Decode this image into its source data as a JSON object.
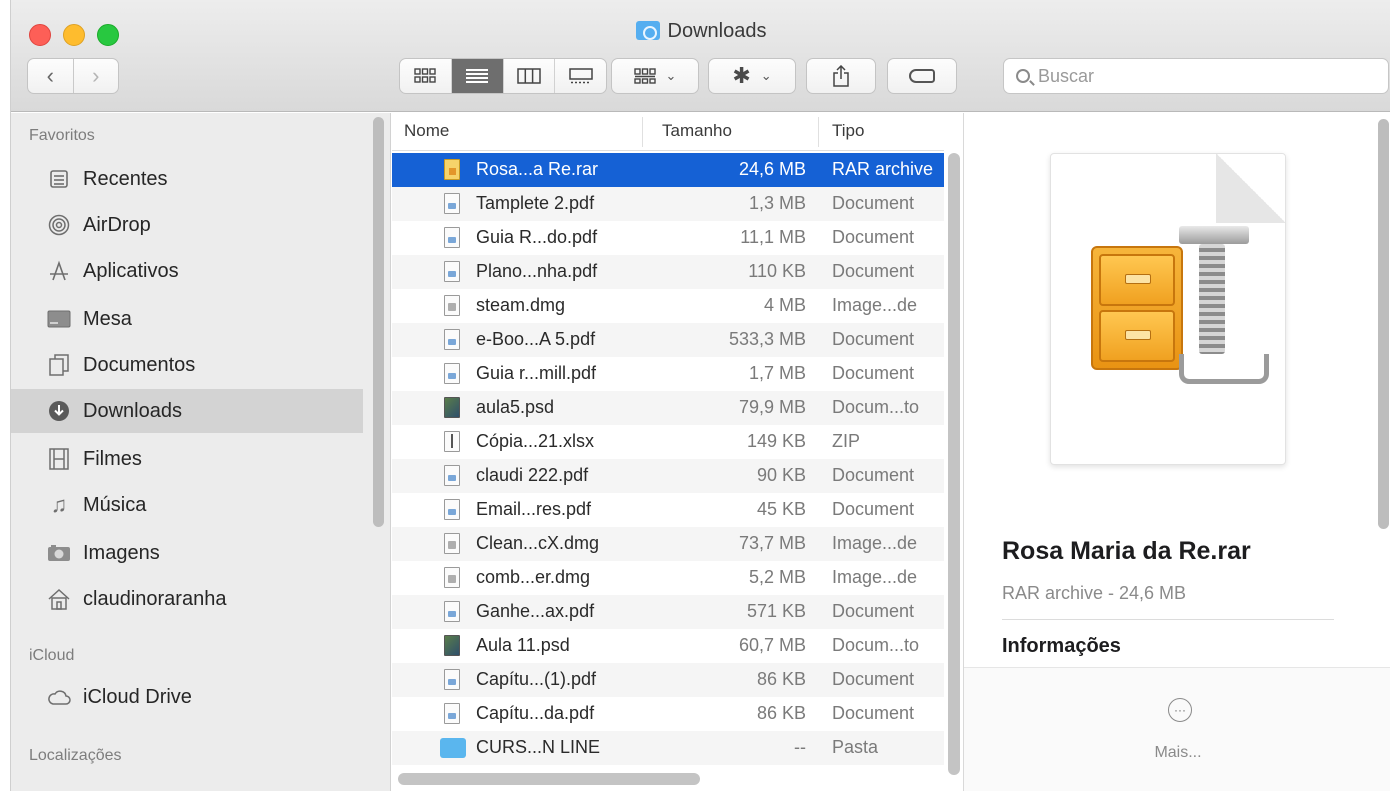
{
  "window": {
    "title": "Downloads"
  },
  "toolbar": {
    "back_icon": "chevron-left",
    "forward_icon": "chevron-right",
    "views": [
      "icon-view",
      "list-view",
      "column-view",
      "gallery-view"
    ],
    "active_view": "list-view",
    "search_placeholder": "Buscar"
  },
  "sidebar": {
    "favorites_label": "Favoritos",
    "favorites": [
      {
        "label": "Recentes",
        "icon": "clock-icon"
      },
      {
        "label": "AirDrop",
        "icon": "airdrop-icon"
      },
      {
        "label": "Aplicativos",
        "icon": "apps-icon"
      },
      {
        "label": "Mesa",
        "icon": "desktop-icon"
      },
      {
        "label": "Documentos",
        "icon": "document-icon"
      },
      {
        "label": "Downloads",
        "icon": "download-icon",
        "selected": true
      },
      {
        "label": "Filmes",
        "icon": "film-icon"
      },
      {
        "label": "Música",
        "icon": "music-icon"
      },
      {
        "label": "Imagens",
        "icon": "camera-icon"
      },
      {
        "label": "claudinoraranha",
        "icon": "home-icon"
      }
    ],
    "icloud_label": "iCloud",
    "icloud_items": [
      {
        "label": "iCloud Drive",
        "icon": "cloud-icon"
      }
    ],
    "locations_label": "Localizações"
  },
  "list": {
    "headers": {
      "name": "Nome",
      "size": "Tamanho",
      "type": "Tipo"
    },
    "rows": [
      {
        "name": "Rosa...a Re.rar",
        "size": "24,6 MB",
        "type": "RAR archive",
        "icon": "rar",
        "selected": true
      },
      {
        "name": "Tamplete 2.pdf",
        "size": "1,3 MB",
        "type": "Document",
        "icon": "pdf"
      },
      {
        "name": "Guia R...do.pdf",
        "size": "11,1 MB",
        "type": "Document",
        "icon": "pdf"
      },
      {
        "name": "Plano...nha.pdf",
        "size": "110 KB",
        "type": "Document",
        "icon": "pdf"
      },
      {
        "name": "steam.dmg",
        "size": "4 MB",
        "type": "Image...de",
        "icon": "dmg"
      },
      {
        "name": "e-Boo...A 5.pdf",
        "size": "533,3 MB",
        "type": "Document",
        "icon": "pdf"
      },
      {
        "name": "Guia r...mill.pdf",
        "size": "1,7 MB",
        "type": "Document",
        "icon": "pdf"
      },
      {
        "name": "aula5.psd",
        "size": "79,9 MB",
        "type": "Docum...to",
        "icon": "psd"
      },
      {
        "name": "Cópia...21.xlsx",
        "size": "149 KB",
        "type": "ZIP",
        "icon": "zip"
      },
      {
        "name": "claudi 222.pdf",
        "size": "90 KB",
        "type": "Document",
        "icon": "pdf"
      },
      {
        "name": "Email...res.pdf",
        "size": "45 KB",
        "type": "Document",
        "icon": "pdf"
      },
      {
        "name": "Clean...cX.dmg",
        "size": "73,7 MB",
        "type": "Image...de",
        "icon": "dmg"
      },
      {
        "name": "comb...er.dmg",
        "size": "5,2 MB",
        "type": "Image...de",
        "icon": "dmg"
      },
      {
        "name": "Ganhe...ax.pdf",
        "size": "571 KB",
        "type": "Document",
        "icon": "pdf"
      },
      {
        "name": "Aula 11.psd",
        "size": "60,7 MB",
        "type": "Docum...to",
        "icon": "psd"
      },
      {
        "name": "Capítu...(1).pdf",
        "size": "86 KB",
        "type": "Document",
        "icon": "pdf"
      },
      {
        "name": "Capítu...da.pdf",
        "size": "86 KB",
        "type": "Document",
        "icon": "pdf"
      },
      {
        "name": "CURS...N LINE",
        "size": "--",
        "type": "Pasta",
        "icon": "folder"
      }
    ]
  },
  "preview": {
    "file_name": "Rosa Maria da Re.rar",
    "file_meta": "RAR archive - 24,6 MB",
    "info_heading": "Informações",
    "more_label": "Mais...",
    "more_glyph": "···"
  }
}
